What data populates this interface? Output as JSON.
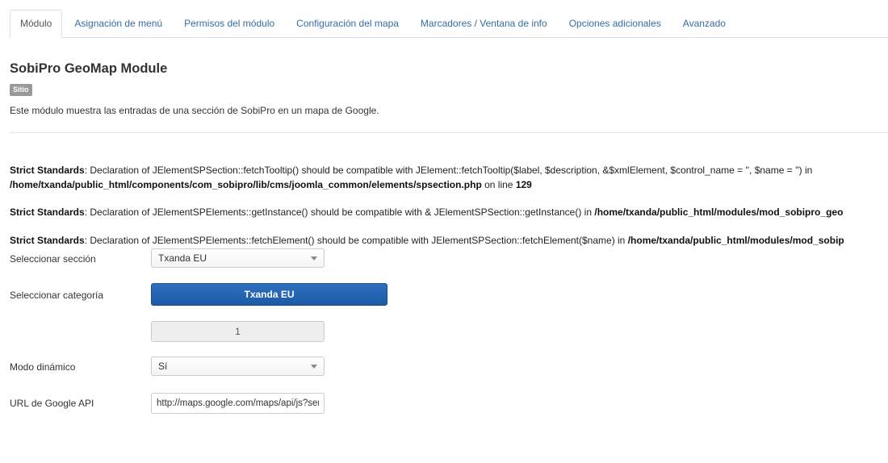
{
  "tabs": [
    {
      "label": "Módulo",
      "active": true
    },
    {
      "label": "Asignación de menú",
      "active": false
    },
    {
      "label": "Permisos del módulo",
      "active": false
    },
    {
      "label": "Configuración del mapa",
      "active": false
    },
    {
      "label": "Marcadores / Ventana de info",
      "active": false
    },
    {
      "label": "Opciones adicionales",
      "active": false
    },
    {
      "label": "Avanzado",
      "active": false
    }
  ],
  "header": {
    "title": "SobiPro GeoMap Module",
    "badge": "Sitio",
    "description": "Este módulo muestra las entradas de una sección de SobiPro en un mapa de Google."
  },
  "warnings": [
    {
      "prefix": "Strict Standards",
      "message": ": Declaration of JElementSPSection::fetchTooltip() should be compatible with JElement::fetchTooltip($label, $description, &$xmlElement, $control_name = '', $name = '') in",
      "path": "/home/txanda/public_html/components/com_sobipro/lib/cms/joomla_common/elements/spsection.php",
      "on_line": " on line ",
      "line": "129"
    },
    {
      "prefix": "Strict Standards",
      "message": ": Declaration of JElementSPElements::getInstance() should be compatible with & JElementSPSection::getInstance() in ",
      "path": "/home/txanda/public_html/modules/mod_sobipro_geo"
    },
    {
      "prefix": "Strict Standards",
      "message": ": Declaration of JElementSPElements::fetchElement() should be compatible with JElementSPSection::fetchElement($name) in ",
      "path": "/home/txanda/public_html/modules/mod_sobip"
    }
  ],
  "form": {
    "section": {
      "label": "Seleccionar sección",
      "value": "Txanda EU"
    },
    "category": {
      "label": "Seleccionar categoría",
      "button_label": "Txanda EU",
      "id_value": "1"
    },
    "dynamic_mode": {
      "label": "Modo dinámico",
      "value": "Sí"
    },
    "google_api": {
      "label": "URL de Google API",
      "value": "http://maps.google.com/maps/api/js?sensor=false"
    }
  },
  "colors": {
    "tab_link": "#336da8",
    "primary_button": "#1c5aa5",
    "badge": "#999999"
  }
}
